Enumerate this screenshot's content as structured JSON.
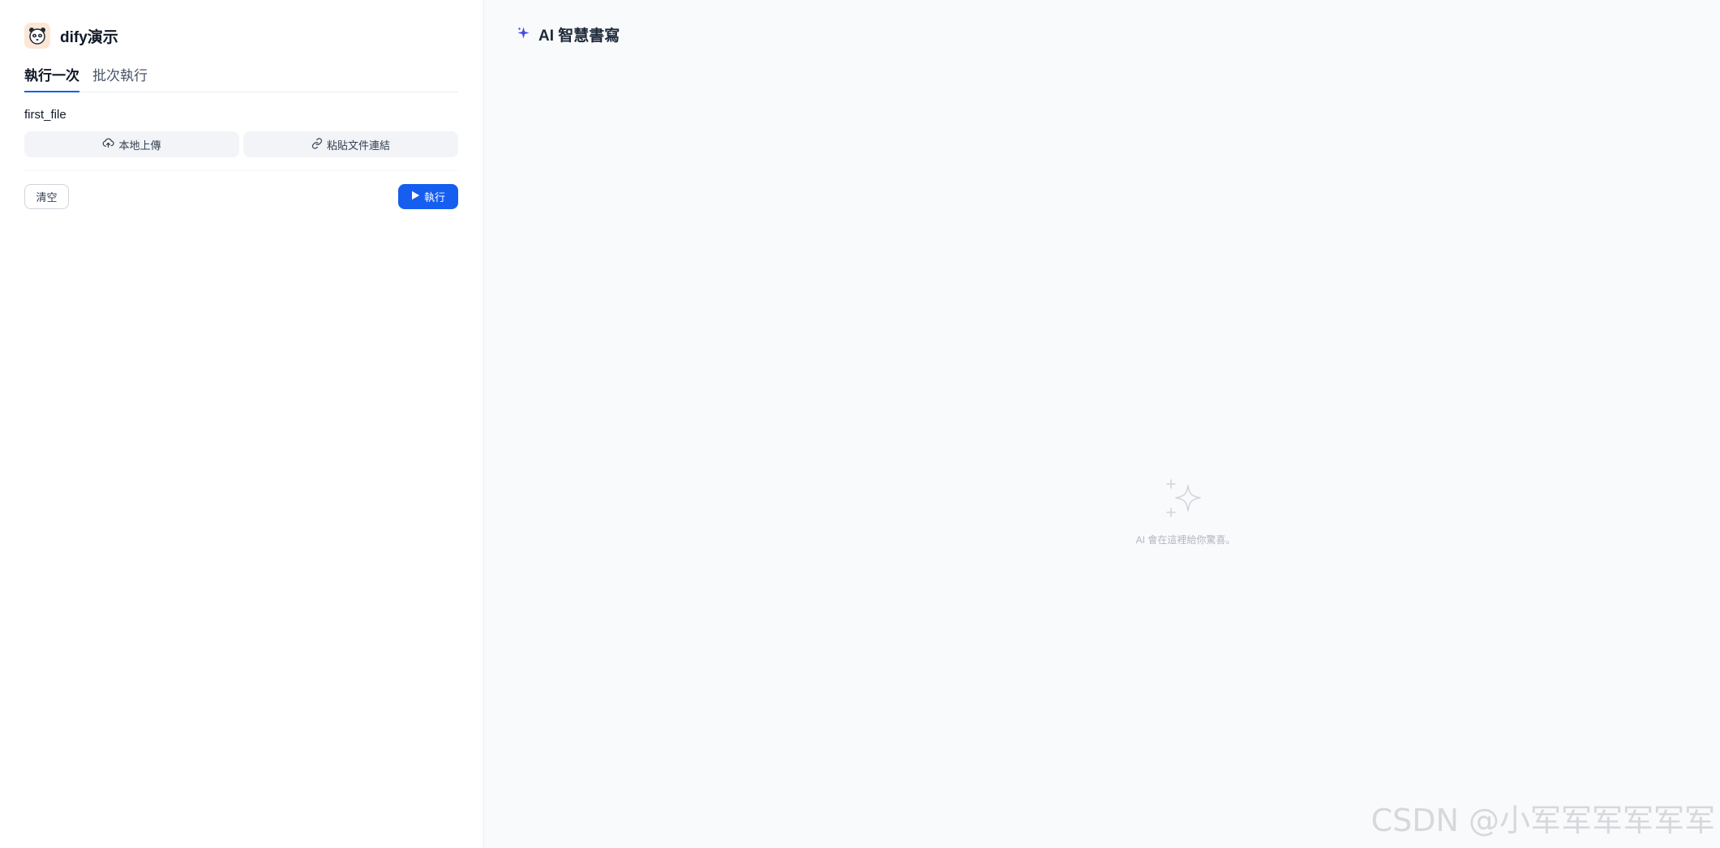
{
  "app": {
    "name": "dify演示"
  },
  "tabs": [
    {
      "label": "執行一次",
      "active": true
    },
    {
      "label": "批次執行",
      "active": false
    }
  ],
  "form": {
    "field_label": "first_file",
    "upload_local_label": "本地上傳",
    "paste_link_label": "粘貼文件連結",
    "clear_label": "清空",
    "run_label": "執行"
  },
  "output": {
    "title": "AI 智慧書寫",
    "empty_text": "AI 會在這裡給你驚喜。"
  },
  "watermark": "CSDN @小军军军军军军",
  "icons": {
    "app_avatar": "panda-avatar-icon",
    "upload": "cloud-upload-icon",
    "link": "link-icon",
    "run": "play-icon",
    "title": "sparkle-icon",
    "empty": "sparkles-icon"
  },
  "colors": {
    "accent": "#155eef",
    "title_sparkle": "#444ce7",
    "avatar_bg": "#fde7d4",
    "right_bg": "#f9fafb"
  }
}
